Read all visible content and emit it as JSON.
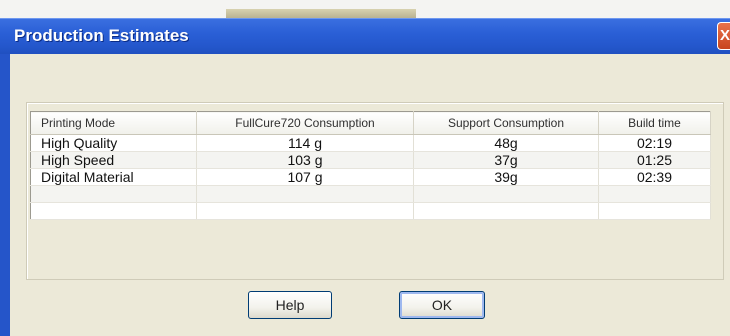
{
  "window": {
    "title": "Production Estimates",
    "close_glyph": "X"
  },
  "table": {
    "columns": [
      "Printing Mode",
      "FullCure720 Consumption",
      "Support Consumption",
      "Build time"
    ],
    "rows": [
      [
        "High Quality",
        "114 g",
        "48g",
        "02:19"
      ],
      [
        "High Speed",
        "103 g",
        "37g",
        "01:25"
      ],
      [
        "Digital Material",
        "107 g",
        "39g",
        "02:39"
      ],
      [
        "",
        "",
        "",
        ""
      ],
      [
        "",
        "",
        "",
        ""
      ]
    ]
  },
  "buttons": {
    "help_label": "Help",
    "ok_label": "OK"
  },
  "colors": {
    "title_bar": "#2457cc",
    "dialog_bg": "#ece9d8",
    "button_border": "#003c74"
  }
}
